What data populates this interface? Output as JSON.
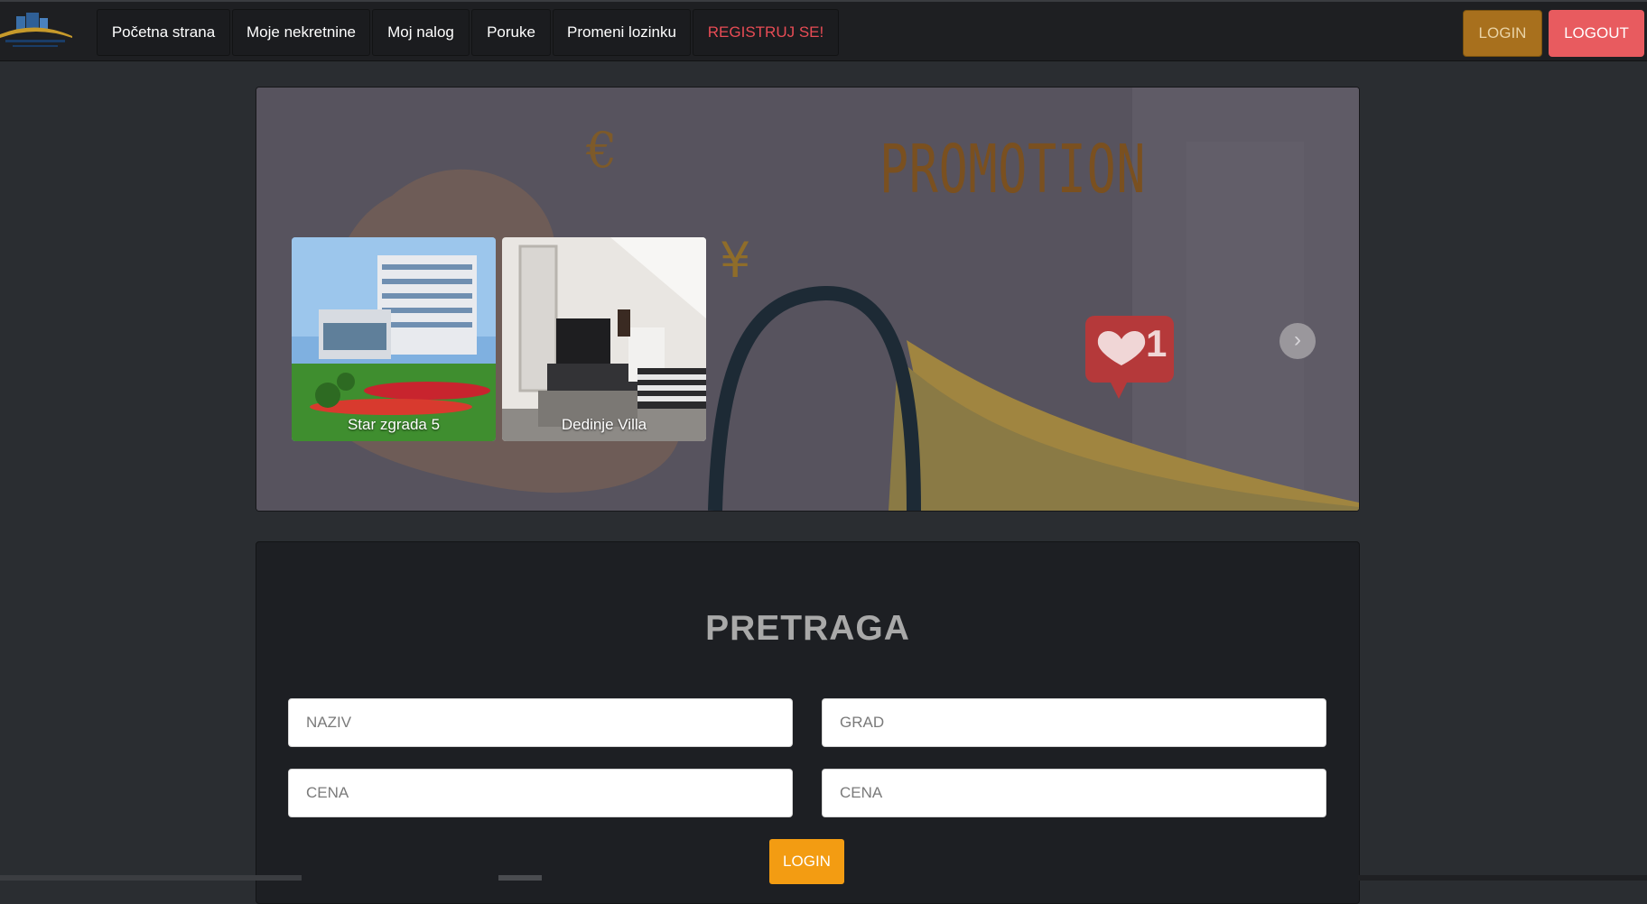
{
  "nav": {
    "logo_icon": "company-logo",
    "links": [
      {
        "label": "Početna strana"
      },
      {
        "label": "Moje nekretnine"
      },
      {
        "label": "Moj nalog"
      },
      {
        "label": "Poruke"
      },
      {
        "label": "Promeni lozinku"
      },
      {
        "label": "REGISTRUJ SE!"
      }
    ],
    "login_label": "LOGIN",
    "logout_label": "LOGOUT"
  },
  "promo": {
    "banner_text": "PROMOTION",
    "badge_count": "1",
    "euro_symbol": "€",
    "yen_symbol": "¥",
    "cards": [
      {
        "caption": "Star zgrada 5"
      },
      {
        "caption": "Dedinje Villa"
      }
    ],
    "next_icon": "chevron-right-icon"
  },
  "search": {
    "title": "PRETRAGA",
    "naziv_placeholder": "NAZIV",
    "grad_placeholder": "GRAD",
    "cena_min_placeholder": "CENA",
    "cena_max_placeholder": "CENA",
    "submit_label": "LOGIN"
  },
  "colors": {
    "accent_orange": "#f39c12",
    "logout_red": "#e85b5f",
    "register_red": "#e84c55",
    "page_bg": "#2a2d31"
  }
}
